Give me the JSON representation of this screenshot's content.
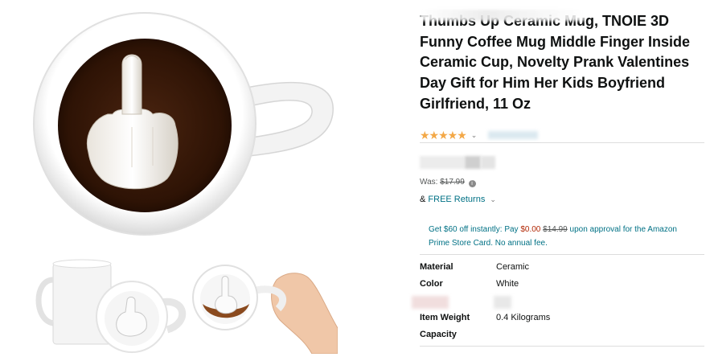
{
  "product": {
    "title": "Thumbs Up Ceramic Mug, TNOIE 3D Funny Coffee Mug Middle Finger Inside Ceramic Cup, Novelty Prank Valentines Day Gift for Him Her Kids Boyfriend Girlfriend, 11 Oz",
    "rating_stars": "★★★★★",
    "rating_chevron": "⌄"
  },
  "pricing": {
    "was_label": "Was:",
    "was_price": "$17.99",
    "info_icon": "i",
    "returns_prefix": "&",
    "returns_link": "FREE Returns",
    "returns_chevron": "⌄"
  },
  "promo": {
    "line_start": "Get $60 off instantly: Pay",
    "pay_price": "$0.00",
    "original_price": "$14.99",
    "line_end": "upon approval for the Amazon Prime Store Card. No annual fee."
  },
  "specs": [
    {
      "key": "Material",
      "value": "Ceramic"
    },
    {
      "key": "Color",
      "value": "White"
    },
    {
      "key": "Item Weight",
      "value": "0.4 Kilograms"
    },
    {
      "key": "Capacity",
      "value": ""
    }
  ],
  "colors": {
    "star": "#f3a847",
    "link": "#007185",
    "price_red": "#b12704",
    "coffee": "#3b1a08"
  }
}
